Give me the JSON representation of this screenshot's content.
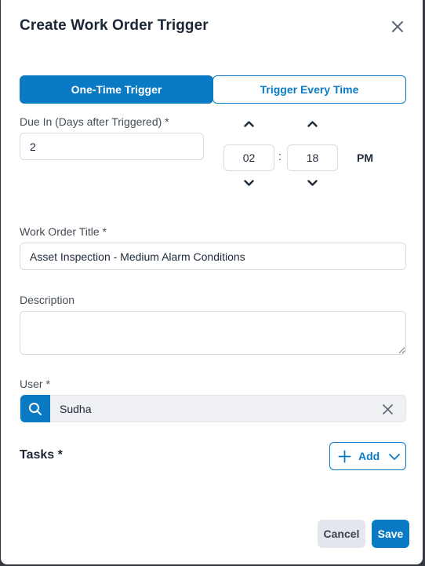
{
  "dialog": {
    "title": "Create Work Order Trigger"
  },
  "trigger_type": {
    "options": [
      "One-Time Trigger",
      "Trigger Every Time"
    ],
    "selected": "One-Time Trigger"
  },
  "due": {
    "label": "Due In (Days after Triggered) *",
    "value": "2"
  },
  "time": {
    "hour": "02",
    "separator": ":",
    "minute": "18",
    "meridiem": "PM"
  },
  "work_order_title": {
    "label": "Work Order Title *",
    "value": "Asset Inspection - Medium Alarm Conditions"
  },
  "description": {
    "label": "Description",
    "value": ""
  },
  "user": {
    "label": "User *",
    "value": "Sudha"
  },
  "tasks": {
    "label": "Tasks *",
    "add_label": "Add"
  },
  "footer": {
    "cancel_label": "Cancel",
    "save_label": "Save"
  },
  "icons": {
    "close": "close-icon",
    "chevron_up": "chevron-up-icon",
    "chevron_down": "chevron-down-icon",
    "search": "search-icon",
    "clear": "clear-icon",
    "plus": "plus-icon"
  },
  "colors": {
    "primary": "#0a7ac4",
    "title_text": "#1c2736",
    "label_text": "#444c56",
    "cancel_bg": "#e3e6ec",
    "user_field_bg": "#eef0f3"
  }
}
